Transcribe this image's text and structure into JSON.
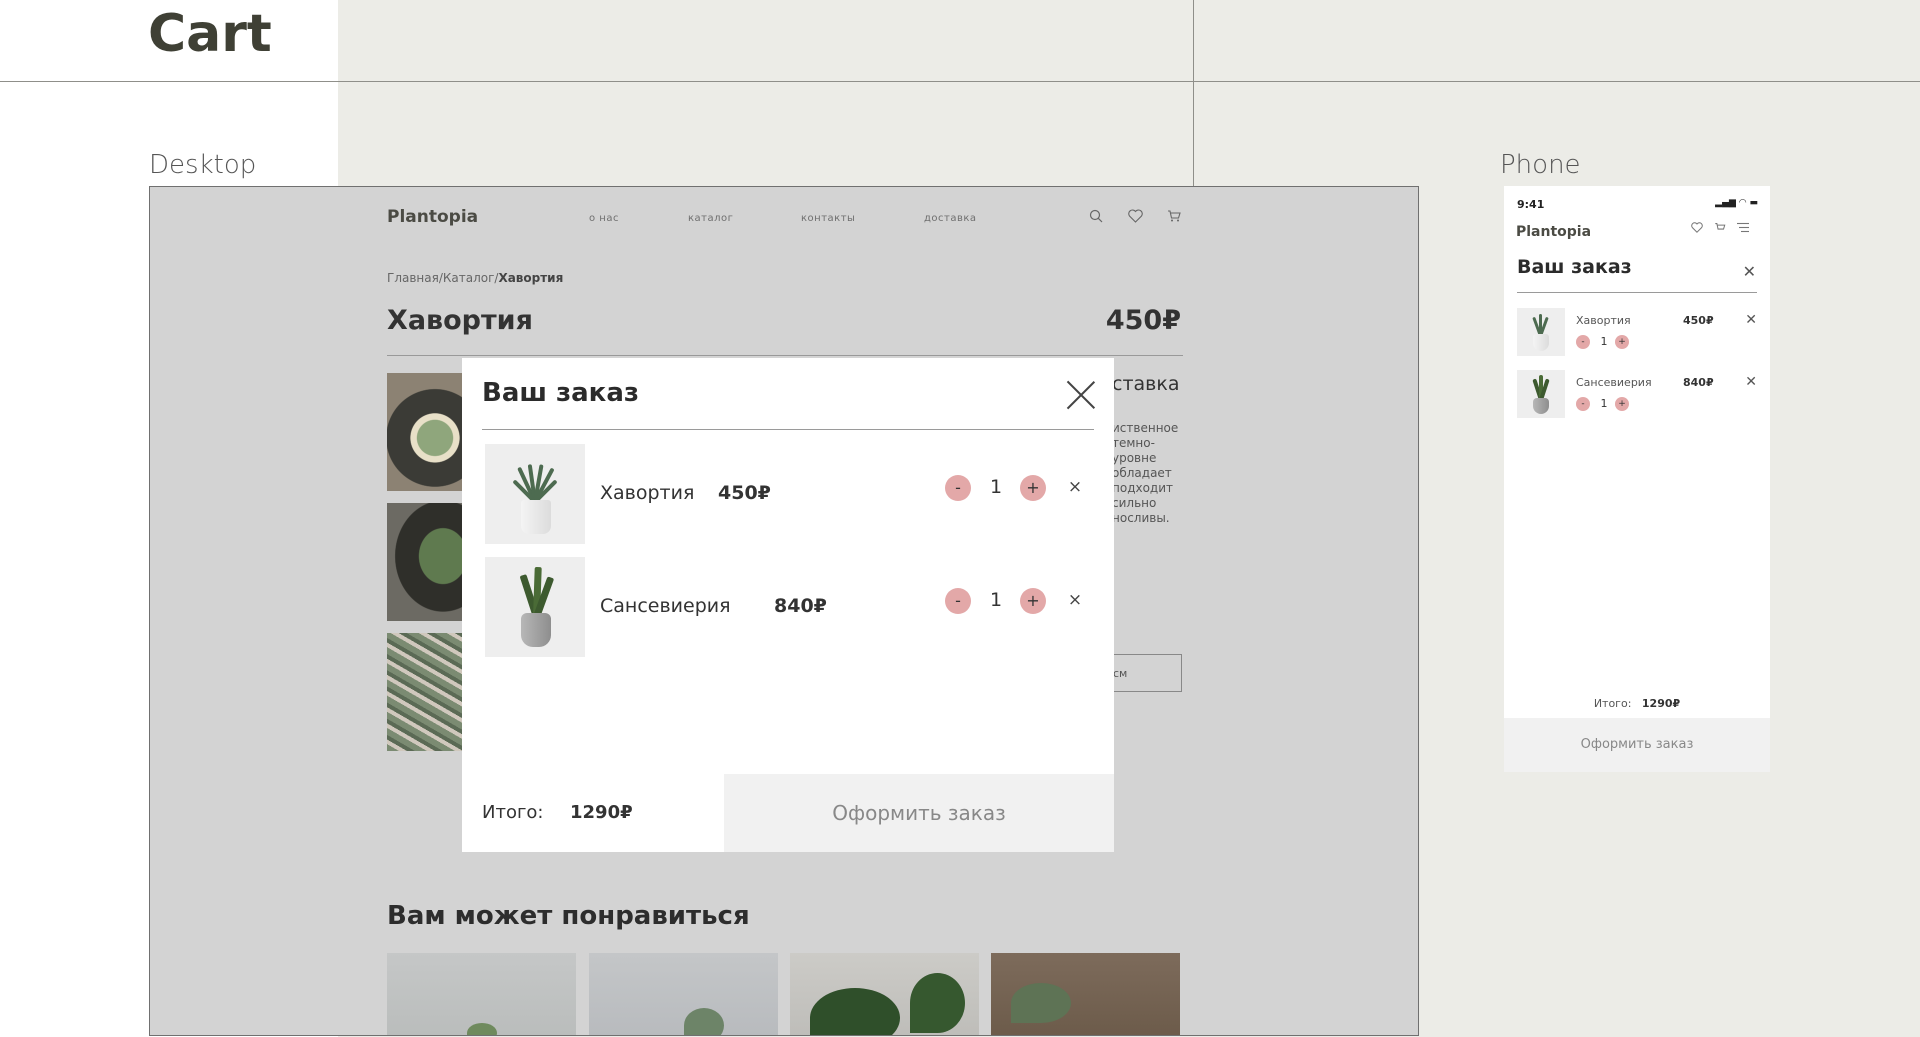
{
  "board": {
    "title": "Cart",
    "desktop_label": "Desktop",
    "phone_label": "Phone"
  },
  "desktop": {
    "logo_text": "Plantopia",
    "nav": [
      "о нас",
      "каталог",
      "контакты",
      "доставка"
    ],
    "icons": [
      "search-icon",
      "heart-icon",
      "cart-icon"
    ],
    "breadcrumb": {
      "home": "Главная/",
      "catalog": "Каталог/",
      "current": "Хавортия"
    },
    "product": {
      "title": "Хавортия",
      "price": "450₽"
    },
    "side_heading": "ставка",
    "side_text": [
      "иственное",
      "темно-",
      "уровне",
      "обладает",
      "подходит",
      "сильно",
      "носливы."
    ],
    "side_button": "см",
    "recommend_title": "Вам может понравиться"
  },
  "modal": {
    "title": "Ваш заказ",
    "items": [
      {
        "name": "Хавортия",
        "price": "450₽",
        "qty": "1",
        "minus": "-",
        "plus": "+",
        "remove": "×"
      },
      {
        "name": "Сансевиерия",
        "price": "840₽",
        "qty": "1",
        "minus": "-",
        "plus": "+",
        "remove": "×"
      }
    ],
    "total_label": "Итого:",
    "total_value": "1290₽",
    "checkout_label": "Оформить заказ"
  },
  "phone": {
    "time": "9:41",
    "status": "▂▄▆ ◠ ▬",
    "logo_text": "Plantopia",
    "title": "Ваш заказ",
    "items": [
      {
        "name": "Хавортия",
        "price": "450₽",
        "qty": "1",
        "minus": "-",
        "plus": "+"
      },
      {
        "name": "Сансевиерия",
        "price": "840₽",
        "qty": "1",
        "minus": "-",
        "plus": "+"
      }
    ],
    "total_label": "Итого:",
    "total_value": "1290₽",
    "checkout_label": "Оформить заказ"
  },
  "colors": {
    "accent_pink": "#e3a8a8",
    "brand_red": "#b55a55",
    "background": "#ecece7"
  }
}
